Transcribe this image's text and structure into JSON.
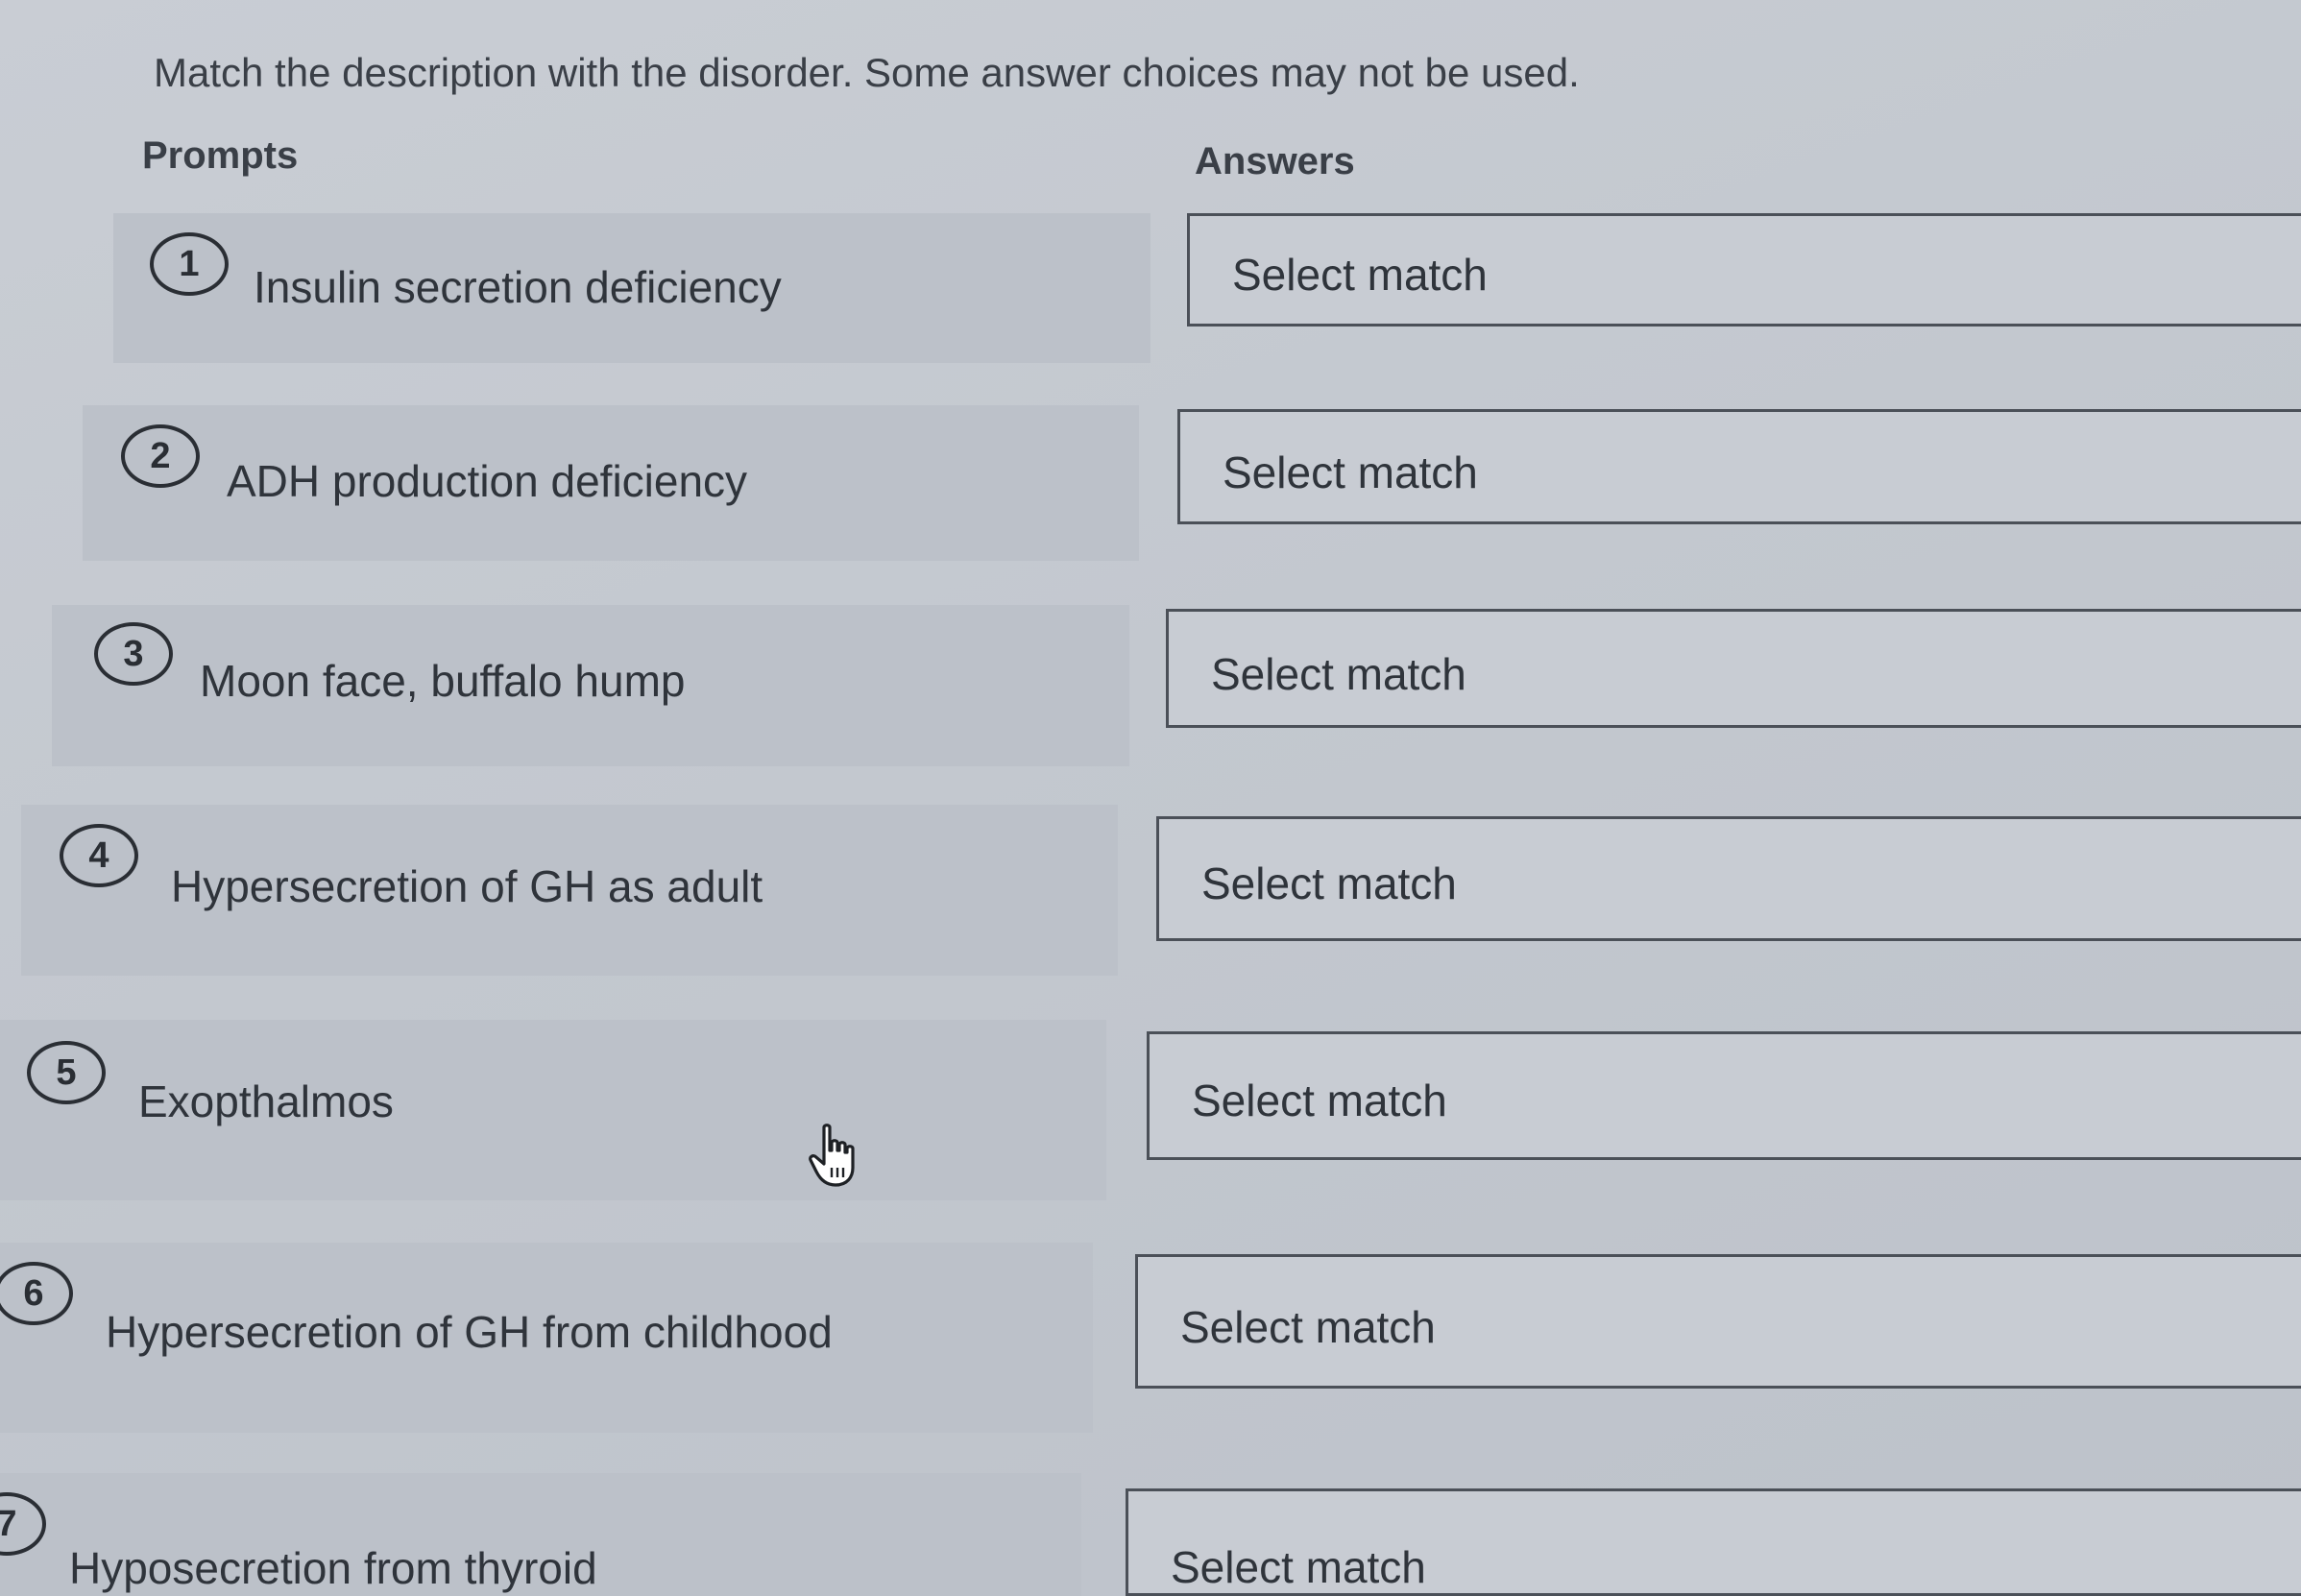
{
  "instruction": "Match the description with the disorder. Some answer choices may not be used.",
  "headers": {
    "prompts": "Prompts",
    "answers": "Answers"
  },
  "prompts": [
    {
      "number": "1",
      "text": "Insulin secretion deficiency"
    },
    {
      "number": "2",
      "text": "ADH production deficiency"
    },
    {
      "number": "3",
      "text": "Moon face, buffalo hump"
    },
    {
      "number": "4",
      "text": "Hypersecretion of GH as adult"
    },
    {
      "number": "5",
      "text": "Exopthalmos"
    },
    {
      "number": "6",
      "text": "Hypersecretion of GH from childhood"
    },
    {
      "number": "7",
      "text": "Hyposecretion from thyroid"
    }
  ],
  "answers": [
    {
      "label": "Select match"
    },
    {
      "label": "Select match"
    },
    {
      "label": "Select match"
    },
    {
      "label": "Select match"
    },
    {
      "label": "Select match"
    },
    {
      "label": "Select match"
    },
    {
      "label": "Select match"
    }
  ],
  "cursor_icon": "hand-pointer-icon"
}
